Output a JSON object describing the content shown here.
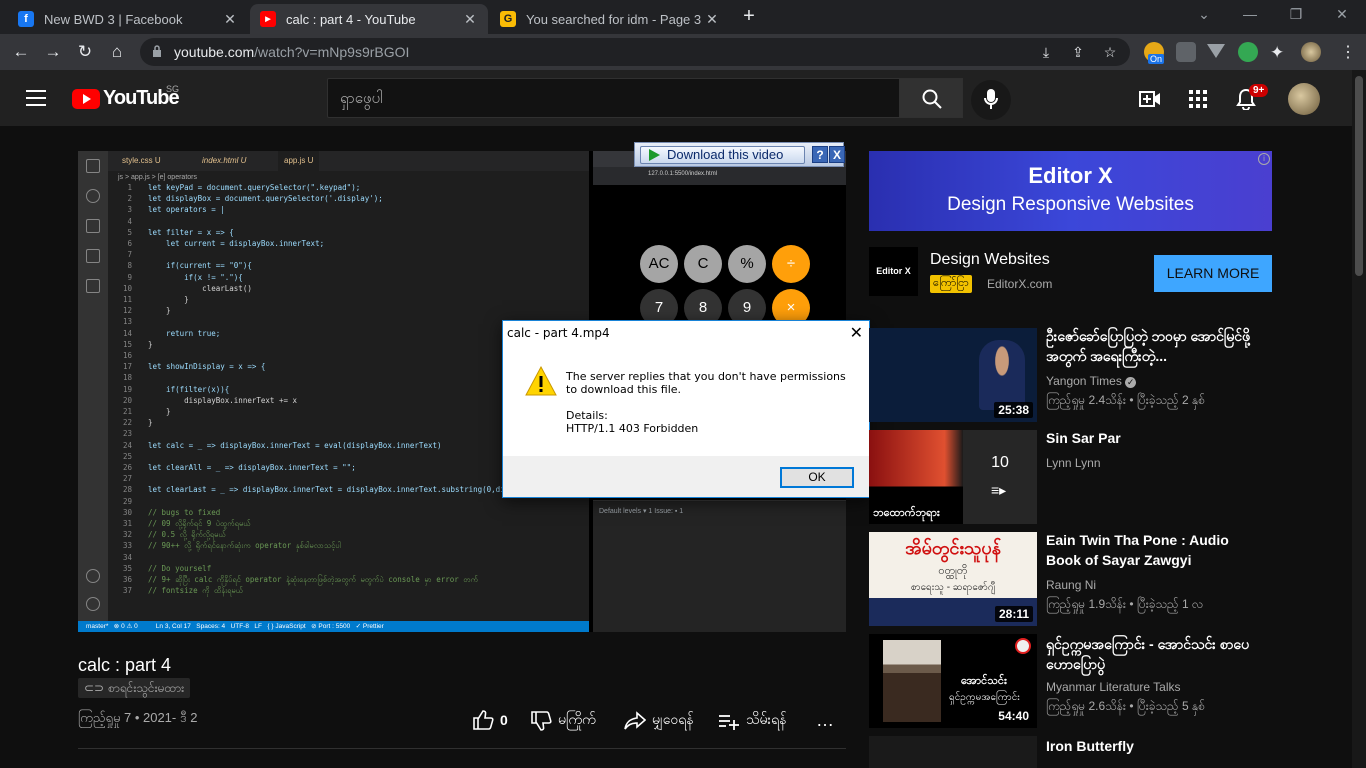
{
  "browser": {
    "tabs": [
      {
        "title": "New BWD 3 | Facebook",
        "favicon": "facebook-icon",
        "color": "#1877f2"
      },
      {
        "title": "calc : part 4 - YouTube",
        "favicon": "youtube-icon",
        "color": "#ff0000"
      },
      {
        "title": "You searched for idm - Page 3 of",
        "favicon": "google-icon",
        "color": "#fbbc05"
      }
    ],
    "url_host": "youtube.com",
    "url_path": "/watch?v=mNp9s9rBGOI",
    "ext_badge": "On"
  },
  "youtube": {
    "logo_text": "YouTube",
    "country": "SG",
    "search_placeholder": "ရှာဖွေပါ",
    "notification_count": "9+"
  },
  "video": {
    "title": "calc : part 4",
    "chip": "စာရင်းသွင်းမထား",
    "meta": "ကြည့်ရှုမှု 7 • 2021- ဒီ 2",
    "actions": {
      "like_count": "0",
      "dislike": "မကြိုက်",
      "share": "မျှဝေရန်",
      "save": "သိမ်းရန်"
    }
  },
  "vscode": {
    "tabs": [
      "style.css U",
      "index.html U",
      "app.js U"
    ],
    "breadcrumb": "js > app.js > [e] operators",
    "lines": [
      [
        "1",
        "let keyPad = document.querySelector(\".keypad\");"
      ],
      [
        "2",
        "let displayBox = document.querySelector('.display');"
      ],
      [
        "3",
        "let operators = |"
      ],
      [
        "4",
        ""
      ],
      [
        "5",
        "let filter = x => {"
      ],
      [
        "6",
        "    let current = displayBox.innerText;"
      ],
      [
        "7",
        ""
      ],
      [
        "8",
        "    if(current == \"0\"){"
      ],
      [
        "9",
        "        if(x != \".\"){"
      ],
      [
        "10",
        "            clearLast()"
      ],
      [
        "11",
        "        }"
      ],
      [
        "12",
        "    }"
      ],
      [
        "13",
        ""
      ],
      [
        "14",
        "    return true;"
      ],
      [
        "15",
        "}"
      ],
      [
        "16",
        ""
      ],
      [
        "17",
        "let showInDisplay = x => {"
      ],
      [
        "18",
        ""
      ],
      [
        "19",
        "    if(filter(x)){"
      ],
      [
        "20",
        "        displayBox.innerText += x"
      ],
      [
        "21",
        "    }"
      ],
      [
        "22",
        "}"
      ],
      [
        "23",
        ""
      ],
      [
        "24",
        "let calc = _ => displayBox.innerText = eval(displayBox.innerText)"
      ],
      [
        "25",
        ""
      ],
      [
        "26",
        "let clearAll = _ => displayBox.innerText = \"\";"
      ],
      [
        "27",
        ""
      ],
      [
        "28",
        "let clearLast = _ => displayBox.innerText = displayBox.innerText.substring(0,di"
      ],
      [
        "29",
        ""
      ],
      [
        "30",
        "// bugs to fixed"
      ],
      [
        "31",
        "// 09 လို့ရိုက်ရင် 9 ပဲထွက်ရမယ်"
      ],
      [
        "32",
        "// 0.5 လို့ ရိုက်လို့ရမယ်"
      ],
      [
        "33",
        "// 90++ လို့ ရိုက်ရင်နောက်ဆုံးက operator နှစ်ခါမလာသင့်ပါ"
      ],
      [
        "34",
        ""
      ],
      [
        "35",
        "// Do yourself"
      ],
      [
        "36",
        "// 9+ ဆိုပြီး calc ကိုနှိပ်ရင် operator နဲ့ဆုံးနေတာဖြစ်တဲ့အတွက် မတွက်ပဲ console မှာ error တက်"
      ],
      [
        "37",
        "// fontsize ကို ထိန်းရမယ်"
      ]
    ],
    "status": "master*   ⊗ 0 ⚠ 0          Ln 3, Col 17   Spaces: 4   UTF-8   LF   { } JavaScript   ⊘ Port : 5500   ✓ Prettier",
    "preview_url": "127.0.0.1:5500/index.html",
    "calc_buttons": [
      [
        "AC",
        "g"
      ],
      [
        "C",
        "g"
      ],
      [
        "%",
        "g"
      ],
      [
        "÷",
        "o"
      ],
      [
        "7",
        "d"
      ],
      [
        "8",
        "d"
      ],
      [
        "9",
        "d"
      ],
      [
        "×",
        "o"
      ]
    ],
    "devtools": "Default levels ▾     1 Issue: ▪ 1"
  },
  "idm": {
    "download_button": "Download this video",
    "help": "?",
    "close": "X"
  },
  "dialog": {
    "title": "calc - part 4.mp4",
    "message": "The server replies that you don't have permissions to download this file.",
    "details_label": "Details:",
    "details": "HTTP/1.1 403 Forbidden",
    "ok": "OK"
  },
  "ad": {
    "banner_title": "Editor X",
    "banner_sub": "Design Responsive Websites",
    "title": "Design Websites",
    "tag": "ကြော်ငြာ",
    "url": "EditorX.com",
    "cta": "LEARN MORE",
    "logo_text": "Editor X"
  },
  "related": [
    {
      "title": "ဦးဇော်ခော်ပြောပြတဲ့ ဘဝမှာ အောင်မြင်ဖို့အတွက် အရေးကြီးတဲ့...",
      "channel": "Yangon Times",
      "meta": "ကြည့်ရှုမှု 2.4သိန်း • ပြီးခဲ့သည့် 2 နှစ်",
      "duration": "25:38",
      "bg": "#0b1d3a"
    },
    {
      "title": "Sin Sar Par",
      "channel": "Lynn Lynn",
      "meta": "",
      "duration": "10",
      "bg": "#1a1a1a"
    },
    {
      "title": "Eain Twin Tha Pone : Audio Book of Sayar Zawgyi",
      "channel": "Raung Ni",
      "meta": "ကြည့်ရှုမှု 1.9သိန်း • ပြီးခဲ့သည့် 1 လ",
      "duration": "28:11",
      "bg": "#f4f0e8"
    },
    {
      "title": "ရှင်ဥက္ကမအကြောင်း - အောင်သင်း စာပေဟောပြောပွဲ",
      "channel": "Myanmar Literature Talks",
      "meta": "ကြည့်ရှုမှု 2.6သိန်း • ပြီးခဲ့သည့် 5 နှစ်",
      "duration": "54:40",
      "bg": "#000"
    },
    {
      "title": "Iron Butterfly",
      "channel": "",
      "meta": "",
      "duration": "",
      "bg": "#111"
    }
  ],
  "thumb_text": {
    "t2_caption": "ဘထောက်ဘုရား",
    "t3_title": "အိမ်တွင်းသူပုန်",
    "t3_sub": "ဝတ္ထုတို",
    "t3_author": "စာရေးသူ - ဆရာဇော်ဂျီ",
    "t4_name": "အောင်သင်း",
    "t4_sub": "ရှင်ဥက္ကမအကြောင်း"
  }
}
